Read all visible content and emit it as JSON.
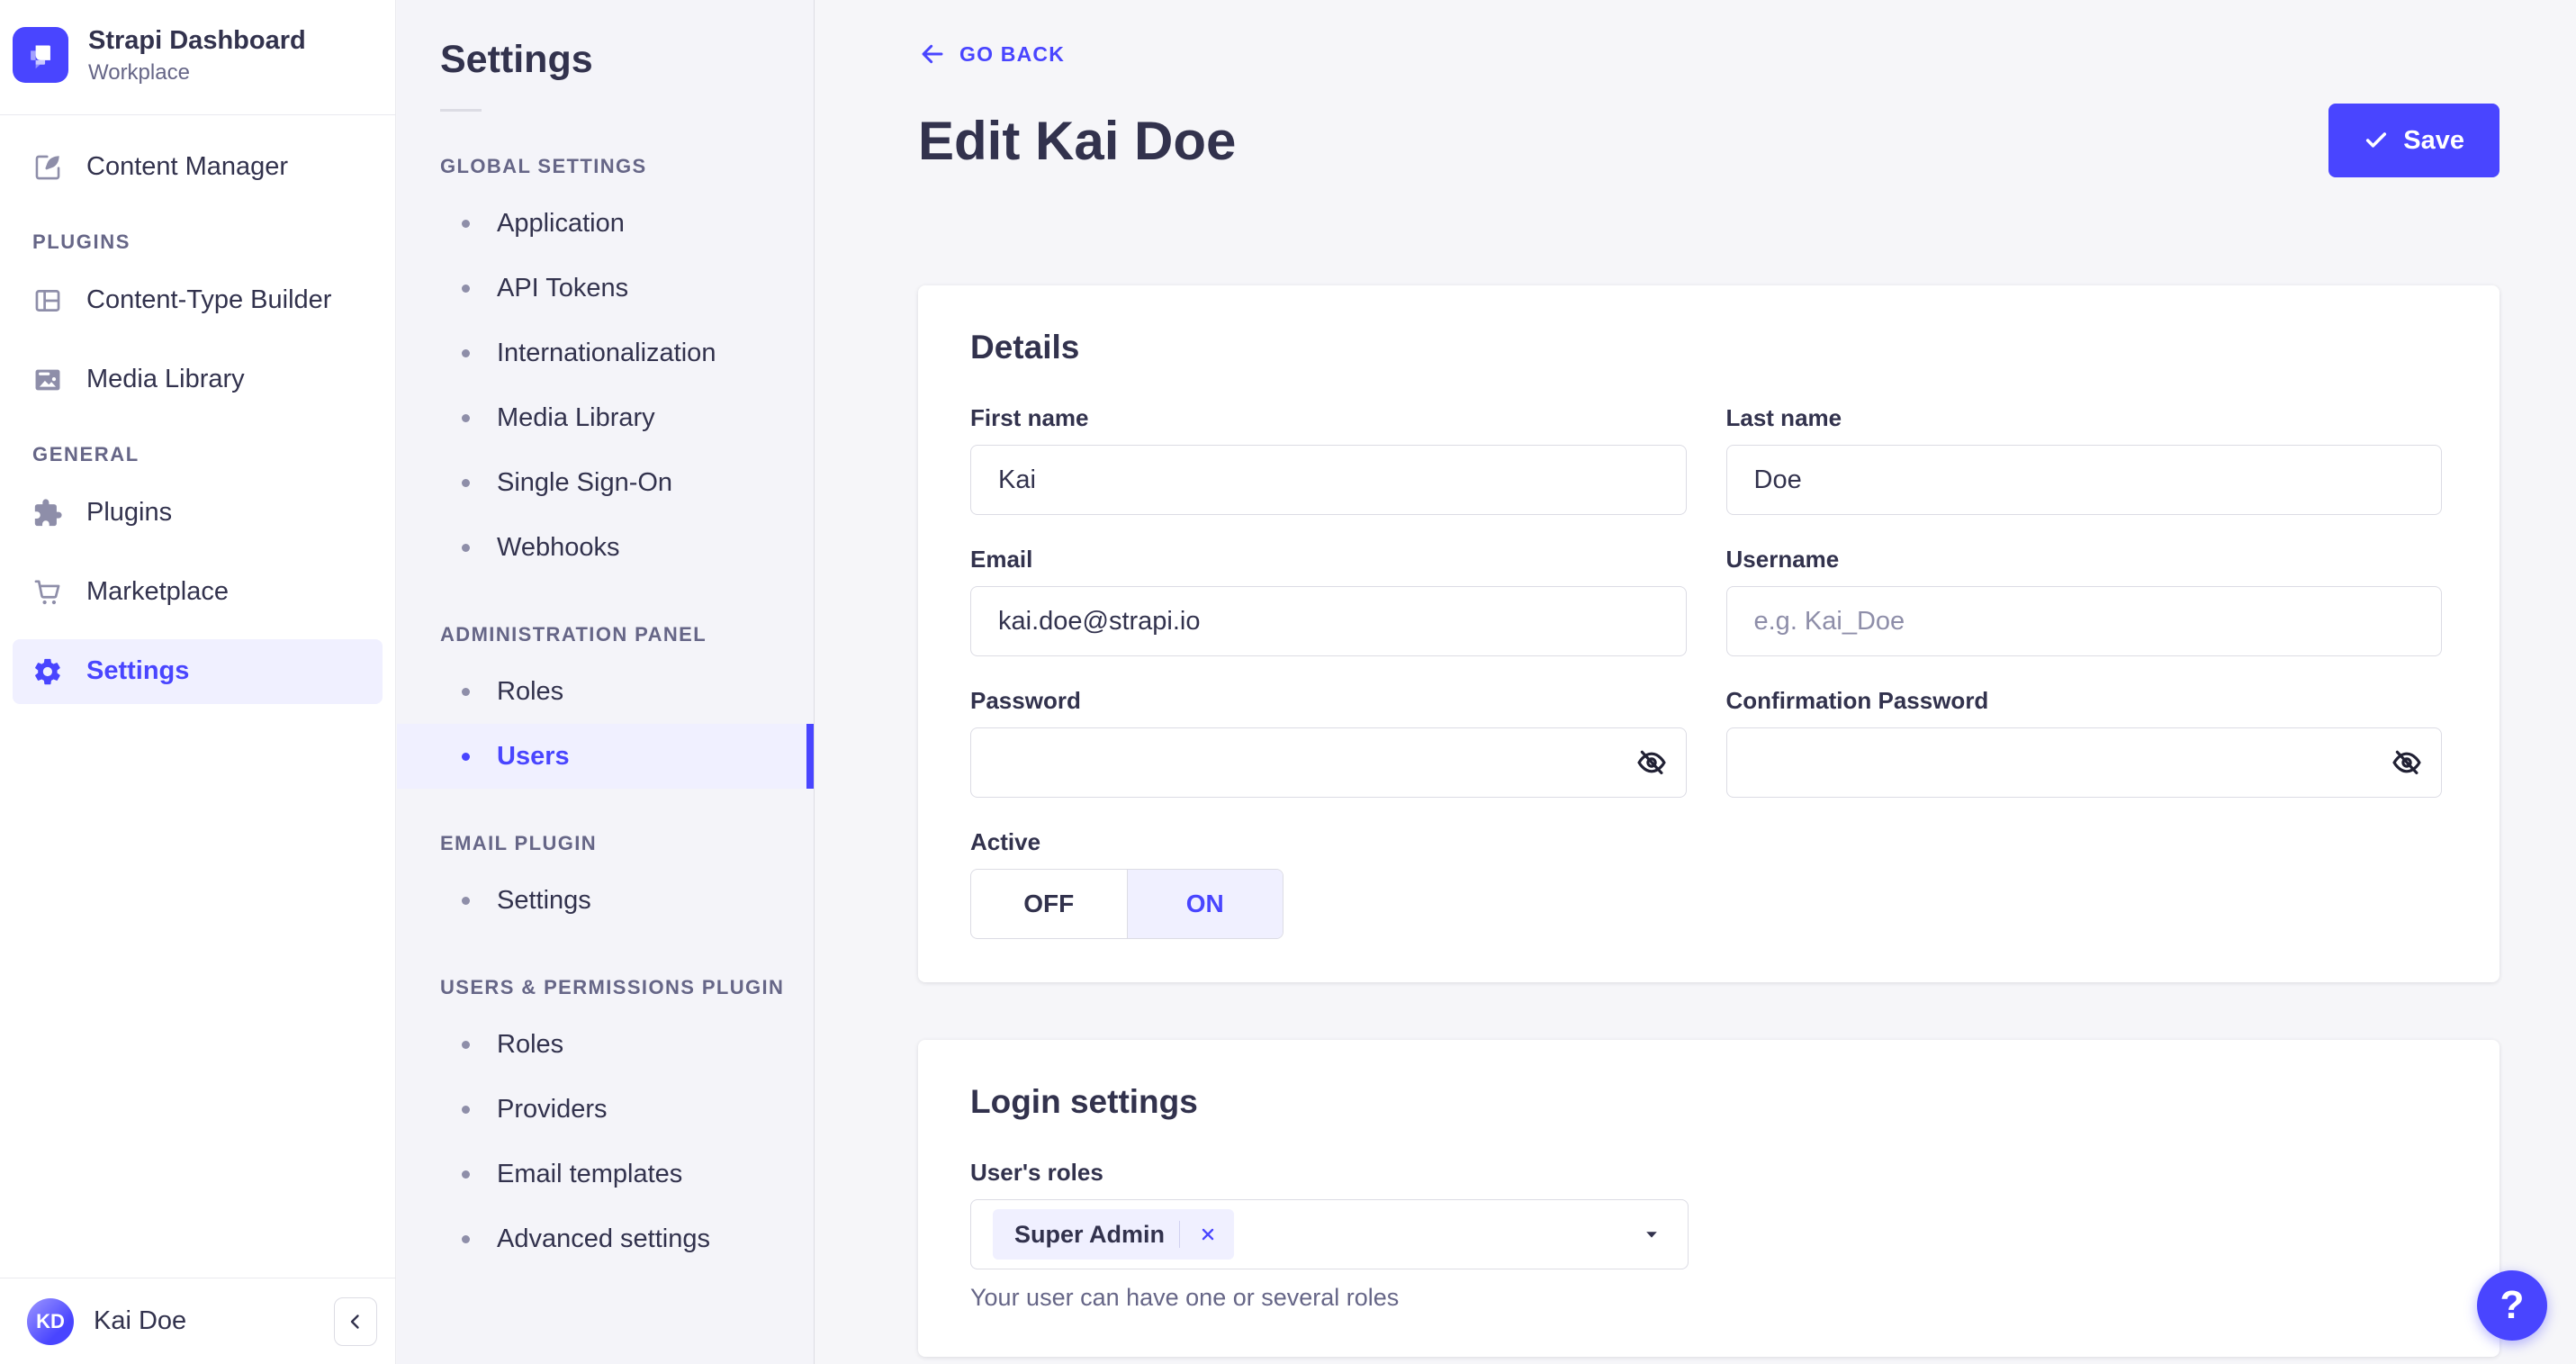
{
  "colors": {
    "primary": "#4945ff",
    "primary_light": "#f0f0ff",
    "text": "#32324d",
    "text_secondary": "#666687",
    "placeholder": "#8e8ea9"
  },
  "brand": {
    "title": "Strapi Dashboard",
    "subtitle": "Workplace"
  },
  "sidebar": {
    "content_manager": {
      "label": "Content Manager"
    },
    "sections": [
      {
        "label": "PLUGINS",
        "items": [
          {
            "label": "Content-Type Builder"
          },
          {
            "label": "Media Library"
          }
        ]
      },
      {
        "label": "GENERAL",
        "items": [
          {
            "label": "Plugins"
          },
          {
            "label": "Marketplace"
          },
          {
            "label": "Settings",
            "active": true
          }
        ]
      }
    ],
    "user": {
      "name": "Kai Doe",
      "initials": "KD"
    }
  },
  "subnav": {
    "title": "Settings",
    "sections": [
      {
        "label": "GLOBAL SETTINGS",
        "items": [
          {
            "label": "Application"
          },
          {
            "label": "API Tokens"
          },
          {
            "label": "Internationalization"
          },
          {
            "label": "Media Library"
          },
          {
            "label": "Single Sign-On"
          },
          {
            "label": "Webhooks"
          }
        ]
      },
      {
        "label": "ADMINISTRATION PANEL",
        "items": [
          {
            "label": "Roles"
          },
          {
            "label": "Users",
            "active": true
          }
        ]
      },
      {
        "label": "EMAIL PLUGIN",
        "items": [
          {
            "label": "Settings"
          }
        ]
      },
      {
        "label": "USERS & PERMISSIONS PLUGIN",
        "items": [
          {
            "label": "Roles"
          },
          {
            "label": "Providers"
          },
          {
            "label": "Email templates"
          },
          {
            "label": "Advanced settings"
          }
        ]
      }
    ]
  },
  "header": {
    "back_label": "GO BACK",
    "title": "Edit Kai Doe",
    "save_label": "Save"
  },
  "details_card": {
    "title": "Details",
    "fields": [
      {
        "label": "First name",
        "value": "Kai"
      },
      {
        "label": "Last name",
        "value": "Doe"
      },
      {
        "label": "Email",
        "value": "kai.doe@strapi.io"
      },
      {
        "label": "Username",
        "placeholder": "e.g. Kai_Doe"
      },
      {
        "label": "Password"
      },
      {
        "label": "Confirmation Password"
      }
    ],
    "active_toggle": {
      "label": "Active",
      "off": "OFF",
      "on": "ON",
      "value": "ON"
    }
  },
  "login_card": {
    "title": "Login settings",
    "roles_label": "User's roles",
    "roles": [
      {
        "name": "Super Admin"
      }
    ],
    "hint": "Your user can have one or several roles"
  },
  "help": {
    "label": "?"
  }
}
